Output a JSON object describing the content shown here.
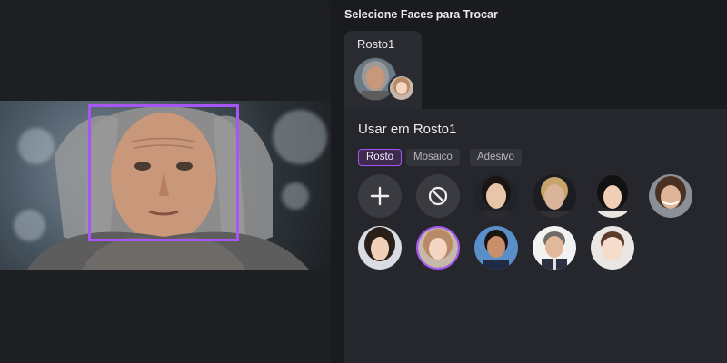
{
  "panel": {
    "title": "Selecione Faces para Trocar",
    "face_tab_label": "Rosto1",
    "use_label": "Usar em Rosto1"
  },
  "modes": [
    "Rosto",
    "Mosaico",
    "Adesivo"
  ],
  "active_mode": "Rosto",
  "colors": {
    "accent": "#a855f7",
    "background": "#1a1b1f",
    "panel": "#26272c"
  },
  "actions": [
    {
      "name": "add-face",
      "icon": "plus-icon"
    },
    {
      "name": "no-face",
      "icon": "ban-icon"
    }
  ],
  "avatars_row1": [
    {
      "skin": "#e8c4a8",
      "hair": "#1a1412"
    },
    {
      "skin": "#d9b49a",
      "hair": "#c9a46a"
    },
    {
      "skin": "#f0cfb6",
      "hair": "#111111"
    },
    {
      "skin": "#dfb497",
      "hair": "#4a3222"
    }
  ],
  "avatars_row2": [
    {
      "skin": "#f1d0ba",
      "hair": "#2b1f1a",
      "selected": false
    },
    {
      "skin": "#f3d5c2",
      "hair": "#b98a66",
      "selected": true
    },
    {
      "skin": "#c98f6a",
      "hair": "#1b1512",
      "selected": false
    },
    {
      "skin": "#e2b89a",
      "hair": "#6f6a66",
      "selected": false
    },
    {
      "skin": "#f6dccb",
      "hair": "#5a3a28",
      "selected": false
    }
  ]
}
